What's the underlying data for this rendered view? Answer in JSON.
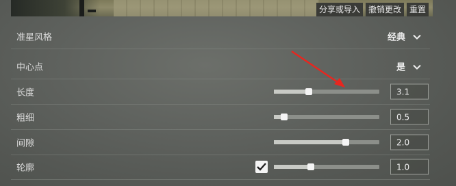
{
  "preview": {
    "buttons": {
      "share": "分享或导入",
      "undo": "撤销更改",
      "reset": "重置"
    }
  },
  "settings": {
    "style": {
      "label": "准星风格",
      "value": "经典"
    },
    "center": {
      "label": "中心点",
      "value": "是"
    },
    "length": {
      "label": "长度",
      "value": "3.1",
      "slider_fraction": 0.33
    },
    "thickness": {
      "label": "粗细",
      "value": "0.5",
      "slider_fraction": 0.1
    },
    "gap": {
      "label": "间隙",
      "value": "2.0",
      "slider_fraction": 0.68
    },
    "outline": {
      "label": "轮廓",
      "value": "1.0",
      "slider_fraction": 0.35,
      "checked": true
    }
  },
  "colors": {
    "annotation_arrow": "#e8261f"
  }
}
